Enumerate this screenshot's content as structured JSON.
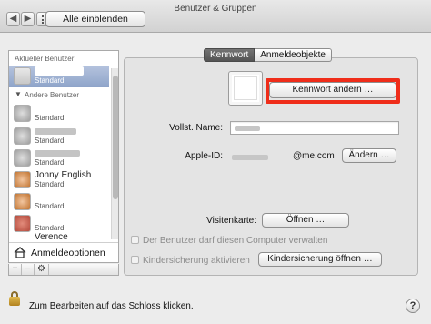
{
  "window": {
    "title": "Benutzer & Gruppen"
  },
  "toolbar": {
    "back_glyph": "◀",
    "forward_glyph": "▶",
    "show_all_label": "Alle einblenden",
    "show_all_icon": "grid-icon"
  },
  "sidebar": {
    "current_header": "Aktueller Benutzer",
    "current_user": {
      "role": "Standard"
    },
    "others_header": "Andere Benutzer",
    "users": [
      {
        "name": "",
        "role": "Standard",
        "avatar": "gray"
      },
      {
        "name": "",
        "role": "Standard",
        "avatar": "gray"
      },
      {
        "name": "",
        "role": "Standard",
        "avatar": "gray"
      },
      {
        "name": "Jonny English",
        "role": "Standard",
        "avatar": "flower"
      },
      {
        "name": "",
        "role": "Standard",
        "avatar": "flower"
      },
      {
        "name": "",
        "role": "Standard",
        "avatar": "red"
      },
      {
        "name": "Verence",
        "role": "",
        "avatar": "red"
      }
    ],
    "login_options": "Anmeldeoptionen",
    "tools": {
      "add": "+",
      "remove": "−",
      "gear": "⚙"
    }
  },
  "tabs": [
    "Kennwort",
    "Anmeldeobjekte"
  ],
  "detail": {
    "change_password_button": "Kennwort ändern …",
    "full_name_label": "Vollst. Name:",
    "full_name_value": "",
    "apple_id_label": "Apple-ID:",
    "apple_id_suffix": "@me.com",
    "change_button": "Ändern …",
    "card_label": "Visitenkarte:",
    "open_button": "Öffnen …",
    "admin_checkbox": "Der Benutzer darf diesen Computer verwalten",
    "parental_checkbox": "Kindersicherung aktivieren",
    "parental_button": "Kindersicherung öffnen …",
    "highlight_color": "#ef2d1a"
  },
  "footer": {
    "lock_text": "Zum Bearbeiten auf das Schloss klicken.",
    "help_glyph": "?"
  }
}
